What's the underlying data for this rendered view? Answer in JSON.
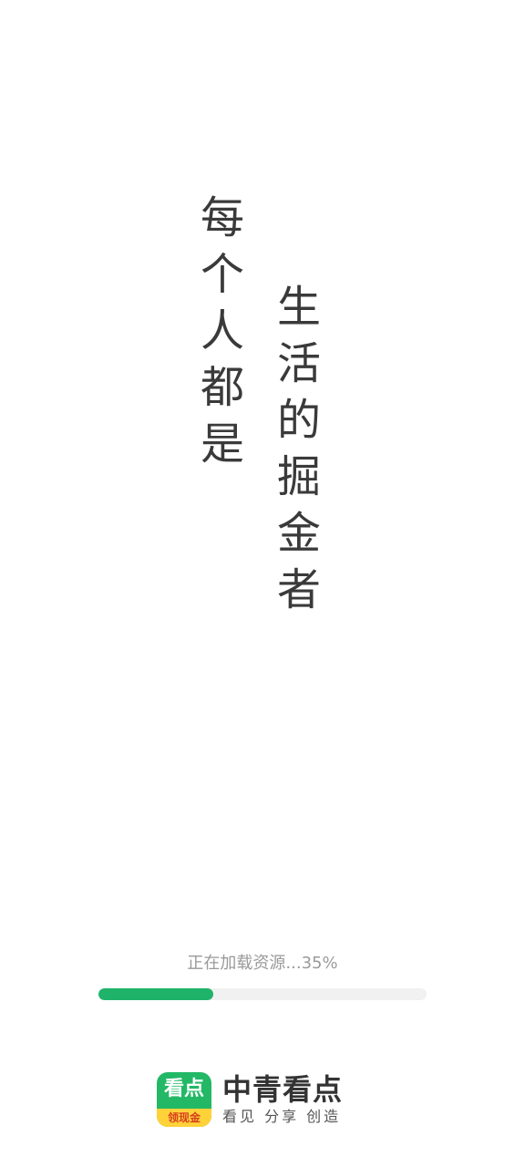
{
  "slogan": {
    "column_left": [
      "每",
      "个",
      "人",
      "都",
      "是"
    ],
    "column_right": [
      "生",
      "活",
      "的",
      "掘",
      "金",
      "者"
    ]
  },
  "loading": {
    "text": "正在加载资源...35%",
    "progress_fraction": 0.35
  },
  "brand": {
    "icon_main": "看点",
    "icon_banner": "领现金",
    "name": "中青看点",
    "tagline": "看见 分享 创造"
  },
  "colors": {
    "background": "#ffffff",
    "progress_fill": "#1fb36a",
    "progress_track": "#f1f1f1",
    "slogan_text": "#3a3a3a",
    "loading_text": "#9a9a9a",
    "icon_green": "#22b866",
    "icon_banner": "#ffd23a"
  }
}
